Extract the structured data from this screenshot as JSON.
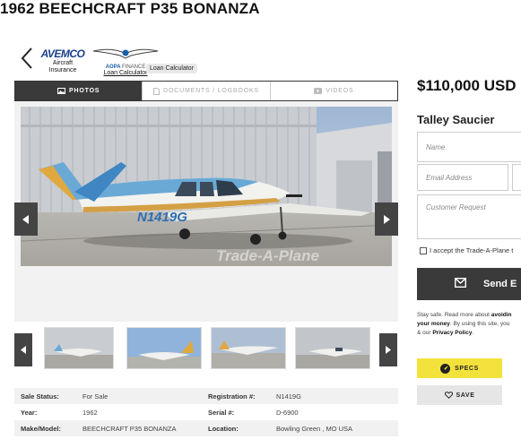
{
  "listing": {
    "title": "1962 BEECHCRAFT P35 BONANZA",
    "price": "$110,000 USD"
  },
  "partners": {
    "avemco_logo": "AVEMCO",
    "avemco_label_1": "Aircraft",
    "avemco_label_2": "Insurance",
    "aopa_label": "AOPA",
    "aopa_finance": "FINANCE",
    "aopa_link": "Loan Calculator",
    "tooltip": "Loan Calculator"
  },
  "tabs": [
    {
      "label": "PHOTOS",
      "icon": "image-icon",
      "active": true
    },
    {
      "label": "DOCUMENTS / LOGBOOKS",
      "icon": "document-icon",
      "active": false
    },
    {
      "label": "VIDEOS",
      "icon": "video-icon",
      "active": false
    }
  ],
  "photo": {
    "tail_number": "N1419G",
    "watermark": "Trade-A-Plane"
  },
  "specs": {
    "rows": [
      {
        "k1": "Sale Status:",
        "v1": "For Sale",
        "k2": "Registration #:",
        "v2": "N1419G"
      },
      {
        "k1": "Year:",
        "v1": "1962",
        "k2": "Serial #:",
        "v2": "D-6900"
      },
      {
        "k1": "Make/Model:",
        "v1": "BEECHCRAFT P35 BONANZA",
        "k2": "Location:",
        "v2": "Bowling Green , MO USA"
      }
    ]
  },
  "contact": {
    "seller_name": "Talley Saucier",
    "name_placeholder": "Name",
    "email_placeholder": "Email Address",
    "request_placeholder": "Customer Request",
    "consent": "I accept the Trade-A-Plane t",
    "send_label": "Send E",
    "legal_1": "Stay safe. Read more about ",
    "legal_bold_1": "avoidin",
    "legal_bold_2": "your money",
    "legal_2": ". By using this site, you",
    "legal_3": "& our ",
    "legal_bold_3": "Privacy Policy",
    "legal_4": "."
  },
  "actions": {
    "specs_label": "SPECS",
    "save_label": "SAVE"
  },
  "colors": {
    "tab_active": "#3a3a3a",
    "specs_button": "#f3e23c",
    "avemco_blue": "#1b3f8b"
  }
}
